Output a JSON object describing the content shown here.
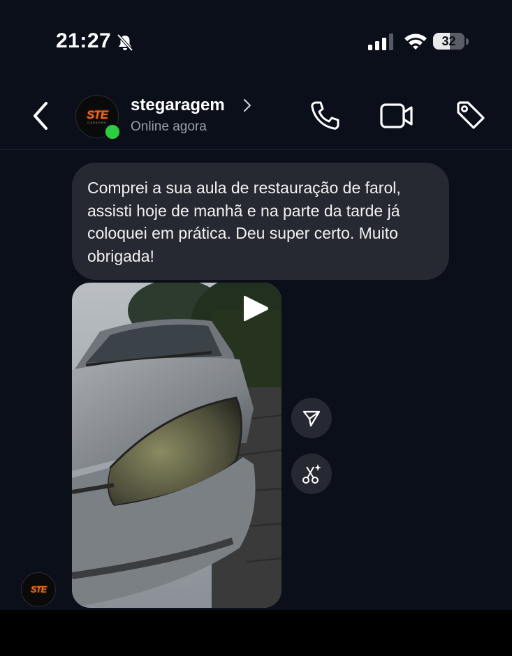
{
  "status_bar": {
    "time": "21:27",
    "battery": "32",
    "icons": [
      "bell-slash-icon",
      "signal-icon",
      "wifi-icon",
      "battery-icon"
    ]
  },
  "header": {
    "username": "stegaragem",
    "presence": "Online agora",
    "avatar_logo": "STE",
    "avatar_logo_sub": "GARAGEM",
    "online_color": "#2ecc40",
    "icons": [
      "back-chevron-icon",
      "chevron-right-icon",
      "phone-icon",
      "video-camera-icon",
      "tag-icon"
    ]
  },
  "messages": [
    {
      "type": "text",
      "text": "Comprei a sua aula de restauração de farol, assisti hoje de manhã  e na parte da tarde já coloquei em prática. Deu super certo. Muito obrigada!"
    },
    {
      "type": "video",
      "description_icons": [
        "play-icon",
        "share-icon",
        "ai-sparkle-icon"
      ]
    }
  ],
  "colors": {
    "background": "#0b0f1a",
    "bubble": "#262931",
    "muted_text": "#9a9ea8"
  }
}
